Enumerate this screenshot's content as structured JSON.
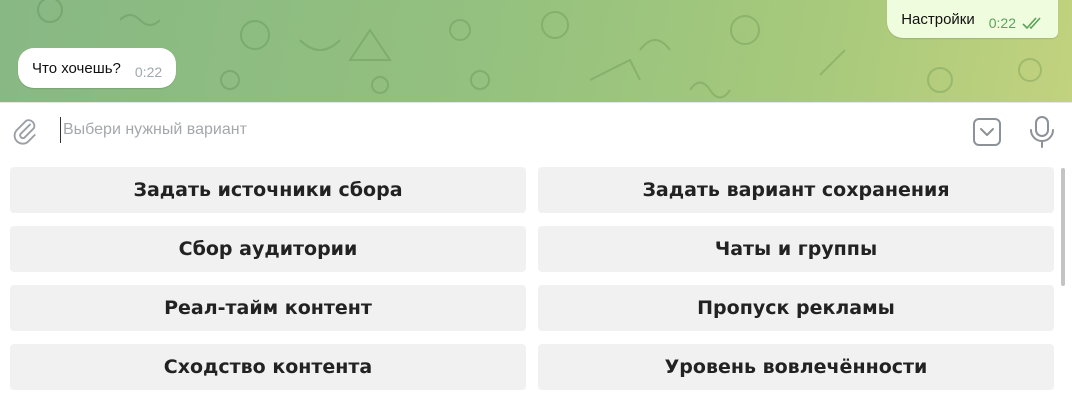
{
  "chat": {
    "outgoing_message": {
      "text": "Настройки",
      "time": "0:22"
    },
    "incoming_message": {
      "text": "Что хочешь?",
      "time": "0:22"
    }
  },
  "composer": {
    "placeholder": "Выбери нужный вариант",
    "icons": [
      "paperclip-icon",
      "keyboard-toggle-icon",
      "microphone-icon"
    ]
  },
  "reply_keyboard": {
    "buttons": [
      {
        "label": "Задать источники сбора"
      },
      {
        "label": "Задать вариант сохранения"
      },
      {
        "label": "Сбор аудитории"
      },
      {
        "label": "Чаты и группы"
      },
      {
        "label": "Реал-тайм контент"
      },
      {
        "label": "Пропуск рекламы"
      },
      {
        "label": "Сходство контента"
      },
      {
        "label": "Уровень вовлечённости"
      }
    ]
  },
  "colors": {
    "wallpaper": "#94c17f",
    "outgoing_bubble": "#effdde",
    "incoming_bubble": "#ffffff",
    "read_ticks": "#58a25b",
    "keyboard_button": "#f1f1f1"
  }
}
